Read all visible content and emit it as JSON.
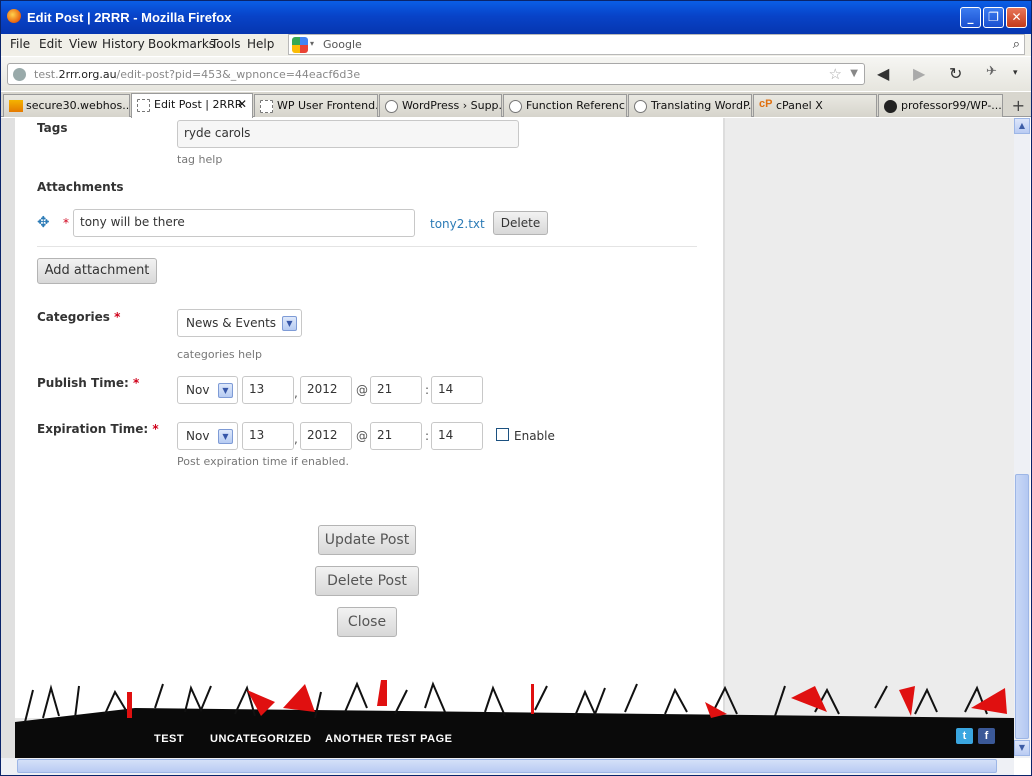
{
  "window": {
    "title": "Edit Post | 2RRR - Mozilla Firefox"
  },
  "menu": [
    "File",
    "Edit",
    "View",
    "History",
    "Bookmarks",
    "Tools",
    "Help"
  ],
  "search": {
    "placeholder": "Google"
  },
  "urlbar": {
    "prefix": "test.",
    "domain": "2rrr.org.au",
    "path": "/edit-post?pid=453&_wpnonce=44eacf6d3e"
  },
  "tabs": [
    {
      "label": "secure30.webhos..."
    },
    {
      "label": "Edit Post | 2RRR"
    },
    {
      "label": "WP User Frontend..."
    },
    {
      "label": "WordPress › Supp..."
    },
    {
      "label": "Function Referenc..."
    },
    {
      "label": "Translating WordP..."
    },
    {
      "label": "cPanel X"
    },
    {
      "label": "professor99/WP-..."
    }
  ],
  "form": {
    "tags": {
      "label": "Tags",
      "value": "ryde carols",
      "help": "tag help"
    },
    "attachments": {
      "label": "Attachments",
      "items": [
        {
          "title": "tony will be there",
          "file": "tony2.txt",
          "delete": "Delete"
        }
      ],
      "add_label": "Add attachment"
    },
    "categories": {
      "label": "Categories",
      "selected": "News & Events",
      "help": "categories help"
    },
    "publish": {
      "label": "Publish Time:",
      "month": "Nov",
      "day": "13",
      "year": "2012",
      "hour": "21",
      "minute": "14"
    },
    "expiration": {
      "label": "Expiration Time:",
      "month": "Nov",
      "day": "13",
      "year": "2012",
      "hour": "21",
      "minute": "14",
      "enable_label": "Enable",
      "help": "Post expiration time if enabled."
    },
    "required_mark": "*",
    "sep_comma": ",",
    "sep_at": "@",
    "sep_colon": ":",
    "buttons": {
      "update": "Update Post",
      "delete": "Delete Post",
      "close": "Close"
    }
  },
  "footer": {
    "links": [
      "TEST",
      "UNCATEGORIZED",
      "ANOTHER TEST PAGE"
    ]
  },
  "colors": {
    "accent_red": "#d0021b",
    "link_blue": "#2c7bb6",
    "titlebar_blue": "#0843c8"
  }
}
